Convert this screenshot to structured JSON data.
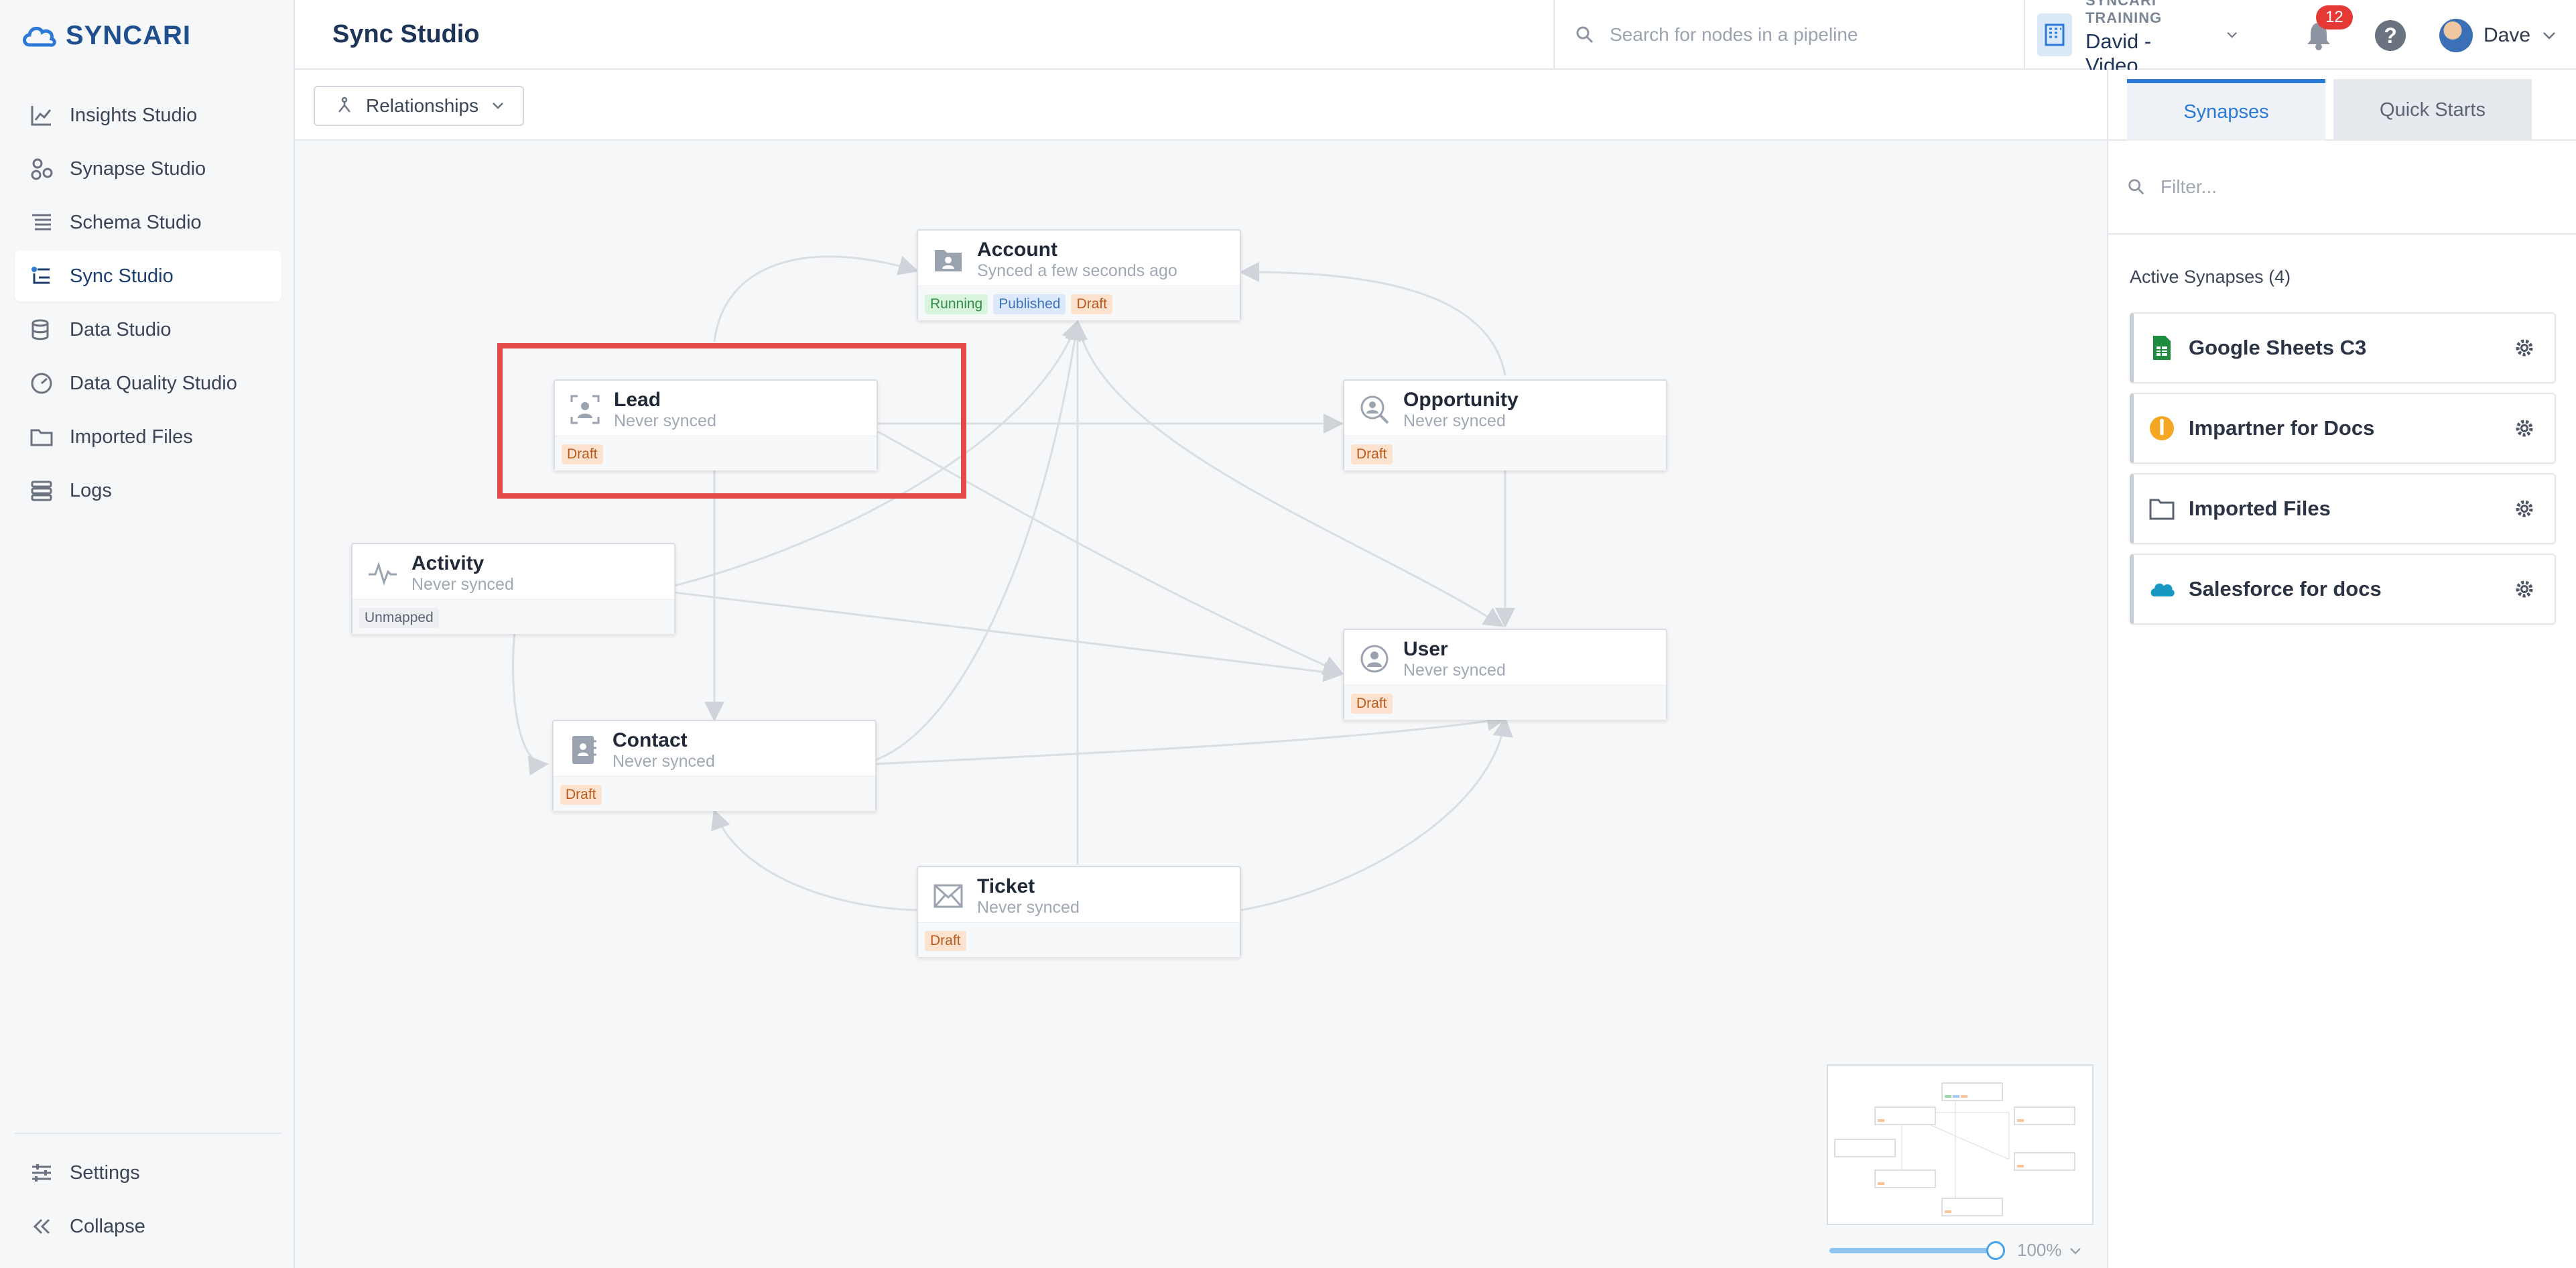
{
  "app": {
    "brand": "SYNCARI"
  },
  "sidebar": {
    "items": [
      {
        "label": "Insights Studio",
        "icon": "chart-line-icon"
      },
      {
        "label": "Synapse Studio",
        "icon": "synapse-icon"
      },
      {
        "label": "Schema Studio",
        "icon": "schema-icon"
      },
      {
        "label": "Sync Studio",
        "icon": "sync-icon",
        "active": true
      },
      {
        "label": "Data Studio",
        "icon": "database-icon"
      },
      {
        "label": "Data Quality Studio",
        "icon": "gauge-icon"
      },
      {
        "label": "Imported Files",
        "icon": "folder-icon"
      },
      {
        "label": "Logs",
        "icon": "logs-icon"
      }
    ],
    "bottom": [
      {
        "label": "Settings",
        "icon": "sliders-icon"
      },
      {
        "label": "Collapse",
        "icon": "double-chevron-left-icon"
      }
    ]
  },
  "header": {
    "title": "Sync Studio",
    "search_placeholder": "Search for nodes in a pipeline",
    "org_label": "SYNCARI TRAINING",
    "org_name": "David - Video",
    "notification_count": "12",
    "help": "?",
    "user_name": "Dave"
  },
  "toolbar": {
    "relationships_label": "Relationships"
  },
  "nodes": {
    "account": {
      "title": "Account",
      "subtitle": "Synced a few seconds ago",
      "tags": [
        "Running",
        "Published",
        "Draft"
      ]
    },
    "lead": {
      "title": "Lead",
      "subtitle": "Never synced",
      "tag": "Draft"
    },
    "opportunity": {
      "title": "Opportunity",
      "subtitle": "Never synced",
      "tag": "Draft"
    },
    "activity": {
      "title": "Activity",
      "subtitle": "Never synced",
      "tag": "Unmapped"
    },
    "user": {
      "title": "User",
      "subtitle": "Never synced",
      "tag": "Draft"
    },
    "contact": {
      "title": "Contact",
      "subtitle": "Never synced",
      "tag": "Draft"
    },
    "ticket": {
      "title": "Ticket",
      "subtitle": "Never synced",
      "tag": "Draft"
    }
  },
  "zoom": {
    "label": "100%",
    "level": 1.0
  },
  "panel": {
    "tabs": [
      "Synapses",
      "Quick Starts"
    ],
    "filter_placeholder": "Filter...",
    "active_label": "Active Synapses (4)",
    "synapses": [
      {
        "name": "Google Sheets C3",
        "icon": "google-sheets-icon",
        "color": "#1e8e3e"
      },
      {
        "name": "Impartner for Docs",
        "icon": "impartner-icon",
        "color": "#f5a623"
      },
      {
        "name": "Imported Files",
        "icon": "folder-icon",
        "color": "#5b6472"
      },
      {
        "name": "Salesforce for docs",
        "icon": "salesforce-icon",
        "color": "#1798c1"
      }
    ]
  },
  "colors": {
    "accent": "#2b7ad6",
    "highlight": "#e24a4a",
    "draft": "#fde3cf",
    "running": "#d9f5de",
    "published": "#dbe9fb"
  }
}
